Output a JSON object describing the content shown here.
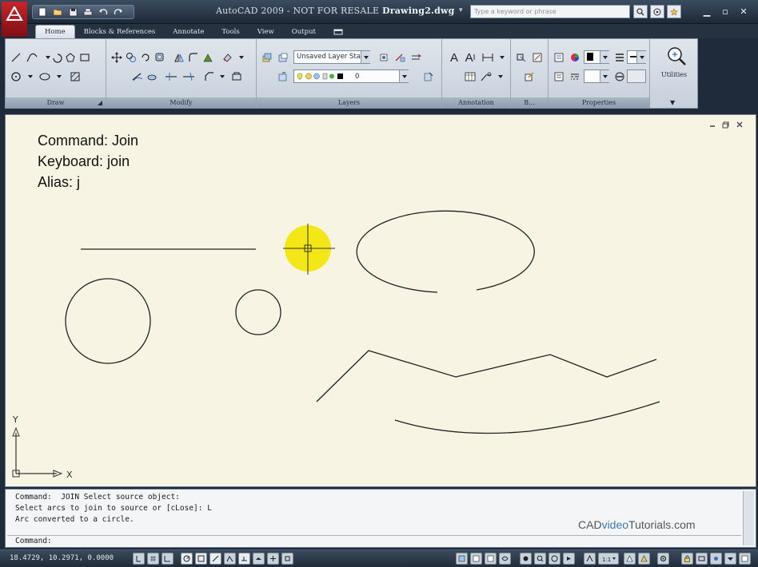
{
  "titlebar": {
    "title_prefix": "AutoCAD 2009 - NOT FOR RESALE",
    "document": "Drawing2.dwg",
    "search_placeholder": "Type a keyword or phrase",
    "icons": [
      "new-icon",
      "open-icon",
      "save-icon",
      "plot-icon",
      "undo-icon",
      "redo-icon"
    ]
  },
  "ribbon": {
    "tabs": [
      "Home",
      "Blocks & References",
      "Annotate",
      "Tools",
      "View",
      "Output"
    ],
    "active_tab": "Home",
    "panels": {
      "draw": "Draw",
      "modify": "Modify",
      "layers": "Layers",
      "annotation": "Annotation",
      "block": "B...",
      "properties": "Properties",
      "utilities": "Utilities"
    },
    "layer_state": "Unsaved Layer State",
    "current_layer": "0"
  },
  "drawing": {
    "overlay_lines": [
      "Command: Join",
      "Keyboard: join",
      "Alias: j"
    ],
    "ucs": {
      "y": "Y",
      "x": "X"
    }
  },
  "command_line": {
    "history": [
      "Command:  JOIN Select source object:",
      "Select arcs to join to source or [cLose]: L",
      "Arc converted to a circle."
    ],
    "prompt": "Command:",
    "watermark_pre": "CAD",
    "watermark_video": "video",
    "watermark_post": "Tutorials.com"
  },
  "status": {
    "coordinates": "18.4729, 10.2971, 0.0000"
  },
  "colors": {
    "canvas_bg": "#f7f4e4",
    "highlight": "#f2e600",
    "app_red": "#c8242a"
  }
}
